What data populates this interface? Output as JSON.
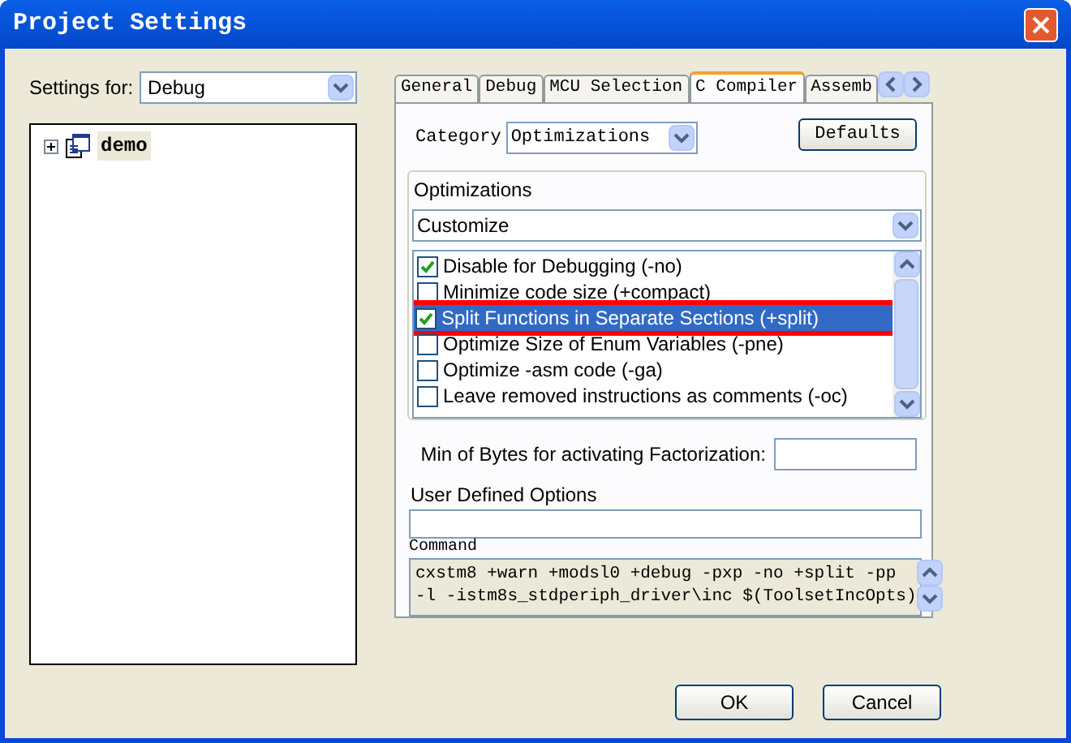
{
  "window": {
    "title": "Project Settings"
  },
  "settings_for": {
    "label": "Settings for:",
    "value": "Debug"
  },
  "tree": [
    {
      "label": "demo",
      "expanded": false,
      "selected": true
    }
  ],
  "tabs": [
    {
      "label": "General",
      "selected": false
    },
    {
      "label": "Debug",
      "selected": false
    },
    {
      "label": "MCU Selection",
      "selected": false
    },
    {
      "label": "C Compiler",
      "selected": true
    },
    {
      "label": "Assemb",
      "selected": false
    }
  ],
  "category": {
    "label": "Category",
    "value": "Optimizations"
  },
  "defaults_button": "Defaults",
  "optimizations": {
    "label": "Optimizations",
    "preset": "Customize",
    "options": [
      {
        "label": "Disable for Debugging (-no)",
        "checked": true,
        "selected": false,
        "highlighted": false
      },
      {
        "label": "Minimize code size (+compact)",
        "checked": false,
        "selected": false,
        "highlighted": false
      },
      {
        "label": "Split Functions in Separate Sections (+split)",
        "checked": true,
        "selected": true,
        "highlighted": true
      },
      {
        "label": "Optimize Size of Enum Variables (-pne)",
        "checked": false,
        "selected": false,
        "highlighted": false
      },
      {
        "label": "Optimize -asm code (-ga)",
        "checked": false,
        "selected": false,
        "highlighted": false
      },
      {
        "label": "Leave removed instructions as comments (-oc)",
        "checked": false,
        "selected": false,
        "highlighted": false
      }
    ]
  },
  "factorization": {
    "label": "Min of Bytes for activating Factorization:"
  },
  "user_options": {
    "label": "User Defined Options"
  },
  "command": {
    "label": "Command",
    "lines": [
      "cxstm8 +warn +modsl0 +debug -pxp -no +split -pp",
      "-l -istm8s_stdperiph_driver\\inc $(ToolsetIncOpts)"
    ]
  },
  "buttons": [
    "OK",
    "Cancel"
  ]
}
